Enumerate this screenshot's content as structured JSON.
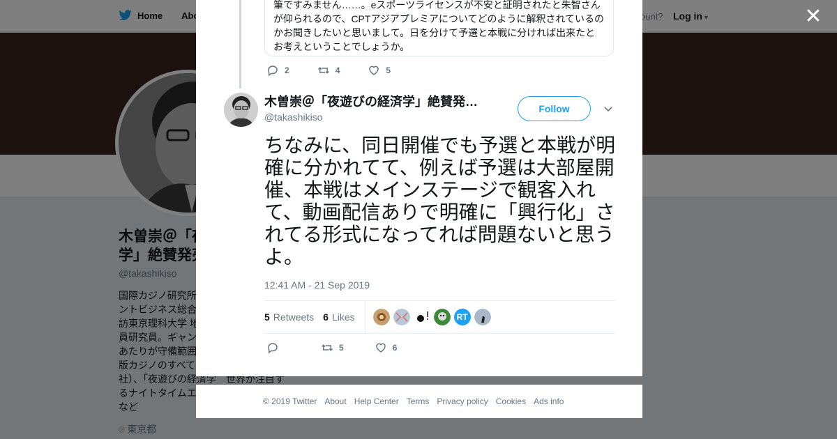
{
  "topbar": {
    "home_label": "Home",
    "about_label": "Abo",
    "account_prompt": "ccount?",
    "login_label": "Log in"
  },
  "profile": {
    "name": "木曽崇＠「夜遊びの経済学」絶賛発売中",
    "name_visible": "木曽崇＠「夜\n学」絶賛発売",
    "handle": "@takashikiso",
    "bio": "国際カジノ研究所\nントビジネス総合\n訪東京理科大学 地\n員研究員。ギャン\nあたりが守備範囲\n版カジノのすべて\n社）、「夜遊びの経済学　世界が注目す\nるナイトタイムエ\nなど",
    "location": "東京都"
  },
  "modal": {
    "quoted_text": "筆ですみません……。eスポーツライセンスが不安と証明されたと朱智さんが仰られるので、CPTアジアプレミアについてどのように解釈されているのかお聞きしたいと思いまして。日を分けて予選と本戦に分ければ出来たとお考えということでしょうか。",
    "parent_actions": {
      "replies": "2",
      "retweets": "4",
      "likes": "5"
    },
    "author": {
      "name": "木曽崇＠「夜遊びの経済学」絶賛発…",
      "handle": "@takashikiso"
    },
    "follow_label": "Follow",
    "tweet_text": "ちなみに、同日開催でも予選と本戦が明確に分かれてて、例えば予選は大部屋開催、本戦はメインステージで観客入れて、動画配信ありで明確に「興行化」されてる形式になってれば問題ないと思うよ。",
    "timestamp": "12:41 AM - 21 Sep 2019",
    "stats": {
      "retweets_count": "5",
      "retweets_label": "Retweets",
      "likes_count": "6",
      "likes_label": "Likes"
    },
    "liker_rt_label": "RT",
    "actions": {
      "retweets": "5",
      "likes": "6"
    }
  },
  "footer": {
    "copyright": "© 2019 Twitter",
    "links": [
      "About",
      "Help Center",
      "Terms",
      "Privacy policy",
      "Cookies",
      "Ads info"
    ]
  },
  "colors": {
    "twitter_blue": "#1da1f2",
    "banner": "#3c2421",
    "muted_text": "#657786",
    "border": "#e6ecf0"
  }
}
